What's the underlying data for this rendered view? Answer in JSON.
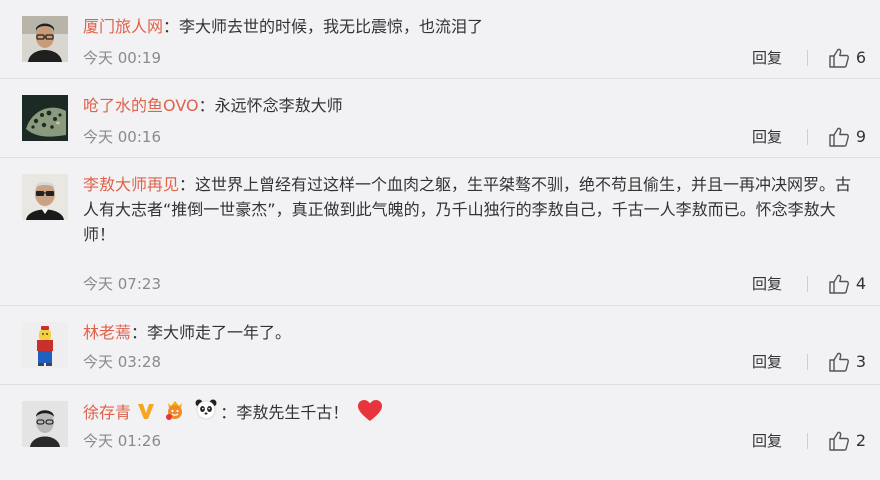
{
  "comments": [
    {
      "username": "厦门旅人网",
      "separator": "：",
      "content": "李大师去世的时候，我无比震惊，也流泪了",
      "time": "今天 00:19",
      "reply_label": "回复",
      "likes": "6",
      "avatar_icon": "avatar-man-glasses"
    },
    {
      "username": "呛了水的鱼OVO",
      "separator": "：",
      "content": "永远怀念李敖大师",
      "time": "今天 00:16",
      "reply_label": "回复",
      "likes": "9",
      "avatar_icon": "avatar-leopard"
    },
    {
      "username": "李敖大师再见",
      "separator": "：",
      "content": "这世界上曾经有过这样一个血肉之躯，生平桀骜不驯，绝不苟且偷生，并且一再冲决网罗。古人有大志者“推倒一世豪杰”，真正做到此气魄的，乃千山独行的李敖自己，千古一人李敖而已。怀念李敖大师！",
      "time": "今天 07:23",
      "reply_label": "回复",
      "likes": "4",
      "avatar_icon": "avatar-old-man-glasses"
    },
    {
      "username": "林老蔫",
      "separator": "：",
      "content": "李大师走了一年了。",
      "time": "今天 03:28",
      "reply_label": "回复",
      "likes": "3",
      "avatar_icon": "avatar-lego-figure"
    },
    {
      "username": "徐存青",
      "separator": "：",
      "content": "李敖先生千古！",
      "time": "今天 01:26",
      "reply_label": "回复",
      "likes": "2",
      "avatar_icon": "avatar-portrait-bw",
      "badges": [
        "vip-v-icon",
        "crown-face-icon",
        "panda-icon"
      ],
      "emoji": "heart-icon"
    }
  ],
  "colors": {
    "username": "#e0624a",
    "text": "#333333",
    "time": "#8a8a8a",
    "background": "#f2f2f5",
    "divider": "#dedee2",
    "badge_v": "#f5a623",
    "heart": "#e8343c"
  }
}
